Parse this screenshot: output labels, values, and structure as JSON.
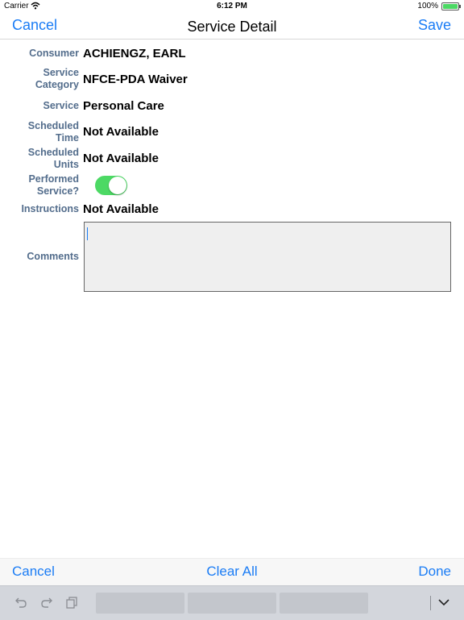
{
  "status_bar": {
    "carrier": "Carrier",
    "time": "6:12 PM",
    "battery": "100%"
  },
  "nav": {
    "cancel": "Cancel",
    "title": "Service Detail",
    "save": "Save"
  },
  "fields": {
    "consumer": {
      "label": "Consumer",
      "value": "ACHIENGZ, EARL"
    },
    "service_category": {
      "label_line1": "Service",
      "label_line2": "Category",
      "value": "NFCE-PDA Waiver"
    },
    "service": {
      "label": "Service",
      "value": "Personal Care"
    },
    "scheduled_time": {
      "label_line1": "Scheduled",
      "label_line2": "Time",
      "value": "Not Available"
    },
    "scheduled_units": {
      "label_line1": "Scheduled",
      "label_line2": "Units",
      "value": "Not Available"
    },
    "performed_service": {
      "label_line1": "Performed",
      "label_line2": "Service?",
      "on": true
    },
    "instructions": {
      "label": "Instructions",
      "value": "Not Available"
    },
    "comments": {
      "label": "Comments",
      "value": ""
    }
  },
  "keyboard_toolbar": {
    "cancel": "Cancel",
    "clear_all": "Clear All",
    "done": "Done"
  },
  "shortcut_bar": {
    "icons": [
      "undo-icon",
      "redo-icon",
      "paste-icon",
      "chevron-down-icon"
    ]
  },
  "colors": {
    "accent": "#1a7cf5",
    "label": "#536d8c",
    "toggle_on": "#4cd964"
  }
}
